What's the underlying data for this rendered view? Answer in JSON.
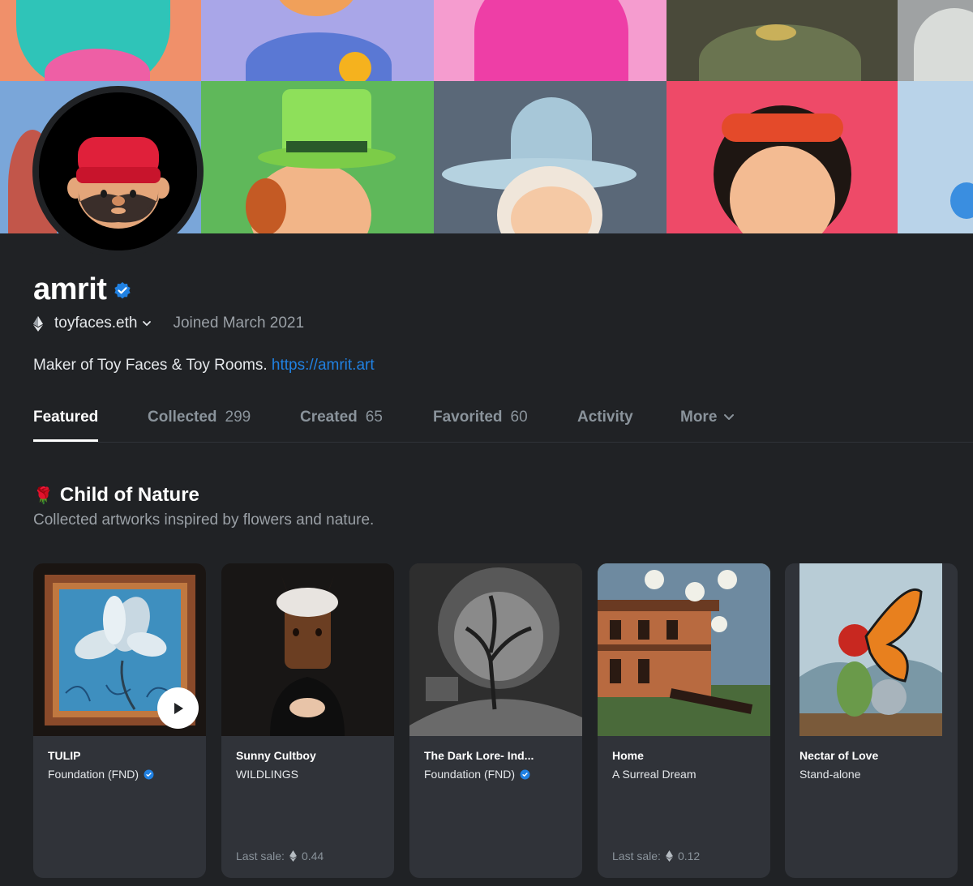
{
  "profile": {
    "name": "amrit",
    "wallet": "toyfaces.eth",
    "joined": "Joined March 2021",
    "bio_text": "Maker of Toy Faces & Toy Rooms.",
    "bio_link": "https://amrit.art"
  },
  "tabs": [
    {
      "label": "Featured",
      "count": "",
      "active": true
    },
    {
      "label": "Collected",
      "count": "299"
    },
    {
      "label": "Created",
      "count": "65"
    },
    {
      "label": "Favorited",
      "count": "60"
    },
    {
      "label": "Activity",
      "count": ""
    },
    {
      "label": "More",
      "count": ""
    }
  ],
  "section": {
    "emoji": "🌹",
    "title": "Child of Nature",
    "subtitle": "Collected artworks inspired by flowers and nature."
  },
  "cards": [
    {
      "title": "TULIP",
      "collection": "Foundation (FND)",
      "verified": true,
      "has_video": true,
      "last_sale_label": "",
      "last_sale_value": ""
    },
    {
      "title": "Sunny Cultboy",
      "collection": "WILDLINGS",
      "verified": false,
      "last_sale_label": "Last sale:",
      "last_sale_value": "0.44"
    },
    {
      "title": "The Dark Lore- Ind...",
      "collection": "Foundation (FND)",
      "verified": true,
      "last_sale_label": "",
      "last_sale_value": ""
    },
    {
      "title": "Home",
      "collection": "A Surreal Dream",
      "verified": false,
      "last_sale_label": "Last sale:",
      "last_sale_value": "0.12"
    },
    {
      "title": "Nectar of Love",
      "collection": "Stand-alone",
      "verified": false,
      "last_sale_label": "",
      "last_sale_value": ""
    }
  ],
  "colors": {
    "background": "#202225",
    "card": "#303339",
    "accent_link": "#2081e2",
    "verified_badge": "#2081e2"
  },
  "icons": {
    "verified": "verified-badge-icon",
    "currency": "ethereum-icon",
    "play": "play-icon",
    "chevron": "chevron-down-icon"
  }
}
